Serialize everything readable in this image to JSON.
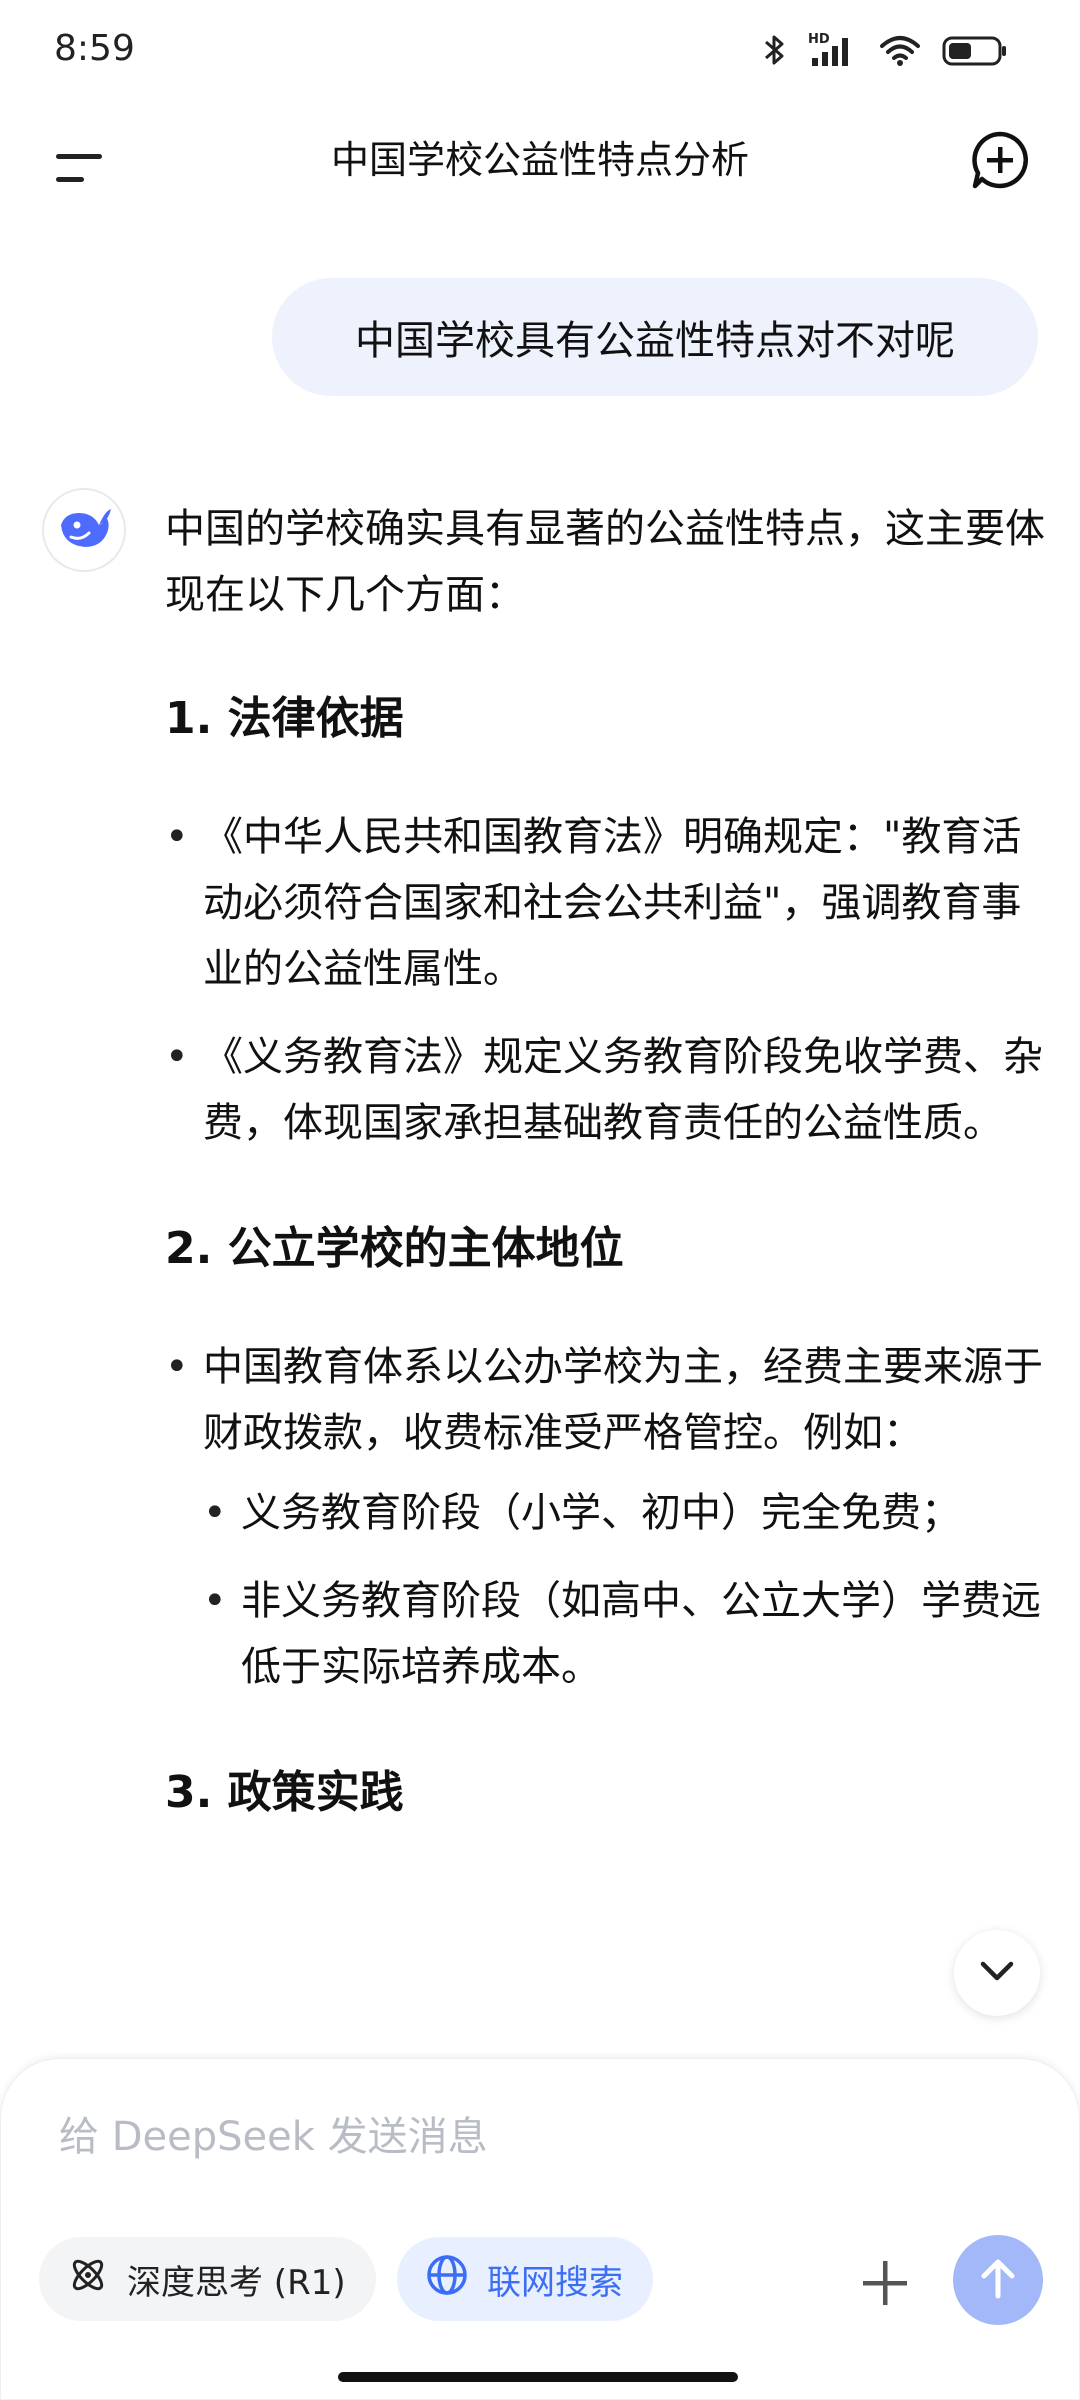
{
  "status_bar": {
    "time": "8:59",
    "icons": [
      "bluetooth-icon",
      "hd-signal-icon",
      "wifi-icon",
      "battery-icon"
    ],
    "signal_label": "HD"
  },
  "header": {
    "title": "中国学校公益性特点分析",
    "menu_icon": "menu-icon",
    "new_chat_icon": "new-chat-icon"
  },
  "user_message": "中国学校具有公益性特点对不对呢",
  "assistant": {
    "avatar_icon": "deepseek-whale-icon",
    "intro": "中国的学校确实具有显著的公益性特点，这主要体现在以下几个方面：",
    "sections": [
      {
        "heading": "1. 法律依据",
        "bullets": [
          "《中华人民共和国教育法》明确规定：\"教育活动必须符合国家和社会公共利益\"，强调教育事业的公益性属性。",
          "《义务教育法》规定义务教育阶段免收学费、杂费，体现国家承担基础教育责任的公益性质。"
        ]
      },
      {
        "heading": "2. 公立学校的主体地位",
        "bullets": [
          "中国教育体系以公办学校为主，经费主要来源于财政拨款，收费标准受严格管控。例如："
        ],
        "sub_bullets": [
          "义务教育阶段（小学、初中）完全免费；",
          "非义务教育阶段（如高中、公立大学）学费远低于实际培养成本。"
        ]
      },
      {
        "heading": "3. 政策实践"
      }
    ]
  },
  "composer": {
    "placeholder": "给 DeepSeek 发送消息",
    "deep_think_label": "深度思考 (R1)",
    "web_search_label": "联网搜索",
    "accent_color": "#3b6ef5",
    "send_color": "#a3b8f8"
  }
}
